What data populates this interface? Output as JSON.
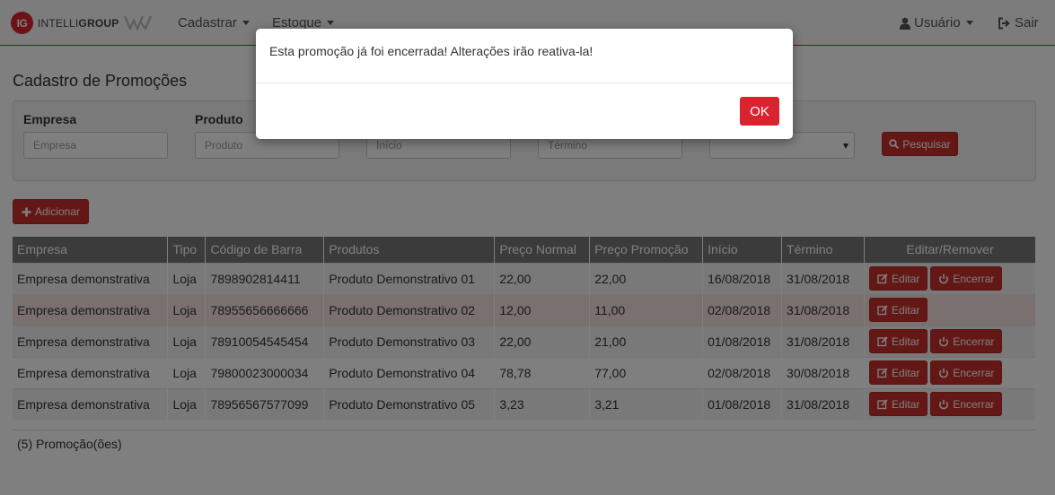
{
  "navbar": {
    "logo_mark": "IG",
    "logo_text_light": "INTELLI",
    "logo_text_bold": "GROUP",
    "menu": [
      {
        "label": "Cadastrar"
      },
      {
        "label": "Estoque"
      }
    ],
    "user_label": "Usuário",
    "logout_label": "Sair",
    "icons": {
      "user": "user-icon",
      "logout": "sign-out-icon"
    }
  },
  "page": {
    "title": "Cadastro de Promoções"
  },
  "search": {
    "fields": [
      {
        "label": "Empresa",
        "placeholder": "Empresa"
      },
      {
        "label": "Produto",
        "placeholder": "Produto"
      },
      {
        "label": "",
        "placeholder": "Início"
      },
      {
        "label": "",
        "placeholder": "Término"
      }
    ],
    "button_label": "Pesquisar",
    "button_icon": "search-icon"
  },
  "add_button": {
    "label": "Adicionar",
    "icon": "plus-icon"
  },
  "table": {
    "columns": [
      "Empresa",
      "Tipo",
      "Código de Barra",
      "Produtos",
      "Preço Normal",
      "Preço Promoção",
      "Início",
      "Término",
      "Editar/Remover"
    ],
    "edit_label": "Editar",
    "end_label": "Encerrar",
    "rows": [
      {
        "empresa": "Empresa demonstrativa",
        "tipo": "Loja",
        "codigo": "7898902814411",
        "produto": "Produto Demonstrativo 01",
        "preco_normal": "22,00",
        "preco_promocao": "22,00",
        "inicio": "16/08/2018",
        "termino": "31/08/2018"
      },
      {
        "empresa": "Empresa demonstrativa",
        "tipo": "Loja",
        "codigo": "78955656666666",
        "produto": "Produto Demonstrativo 02",
        "preco_normal": "12,00",
        "preco_promocao": "11,00",
        "inicio": "02/08/2018",
        "termino": "31/08/2018"
      },
      {
        "empresa": "Empresa demonstrativa",
        "tipo": "Loja",
        "codigo": "78910054545454",
        "produto": "Produto Demonstrativo 03",
        "preco_normal": "22,00",
        "preco_promocao": "21,00",
        "inicio": "01/08/2018",
        "termino": "31/08/2018"
      },
      {
        "empresa": "Empresa demonstrativa",
        "tipo": "Loja",
        "codigo": "79800023000034",
        "produto": "Produto Demonstrativo 04",
        "preco_normal": "78,78",
        "preco_promocao": "77,00",
        "inicio": "02/08/2018",
        "termino": "30/08/2018"
      },
      {
        "empresa": "Empresa demonstrativa",
        "tipo": "Loja",
        "codigo": "78956567577099",
        "produto": "Produto Demonstrativo 05",
        "preco_normal": "3,23",
        "preco_promocao": "3,21",
        "inicio": "01/08/2018",
        "termino": "31/08/2018"
      }
    ],
    "count_text": "(5) Promoção(ões)"
  },
  "modal": {
    "message": "Esta promoção já foi encerrada! Alterações irão reativa-la!",
    "ok_label": "OK"
  },
  "colors": {
    "accent": "#c9302c",
    "header_bg": "#777777",
    "highlight_row": "#f5e1e1"
  }
}
